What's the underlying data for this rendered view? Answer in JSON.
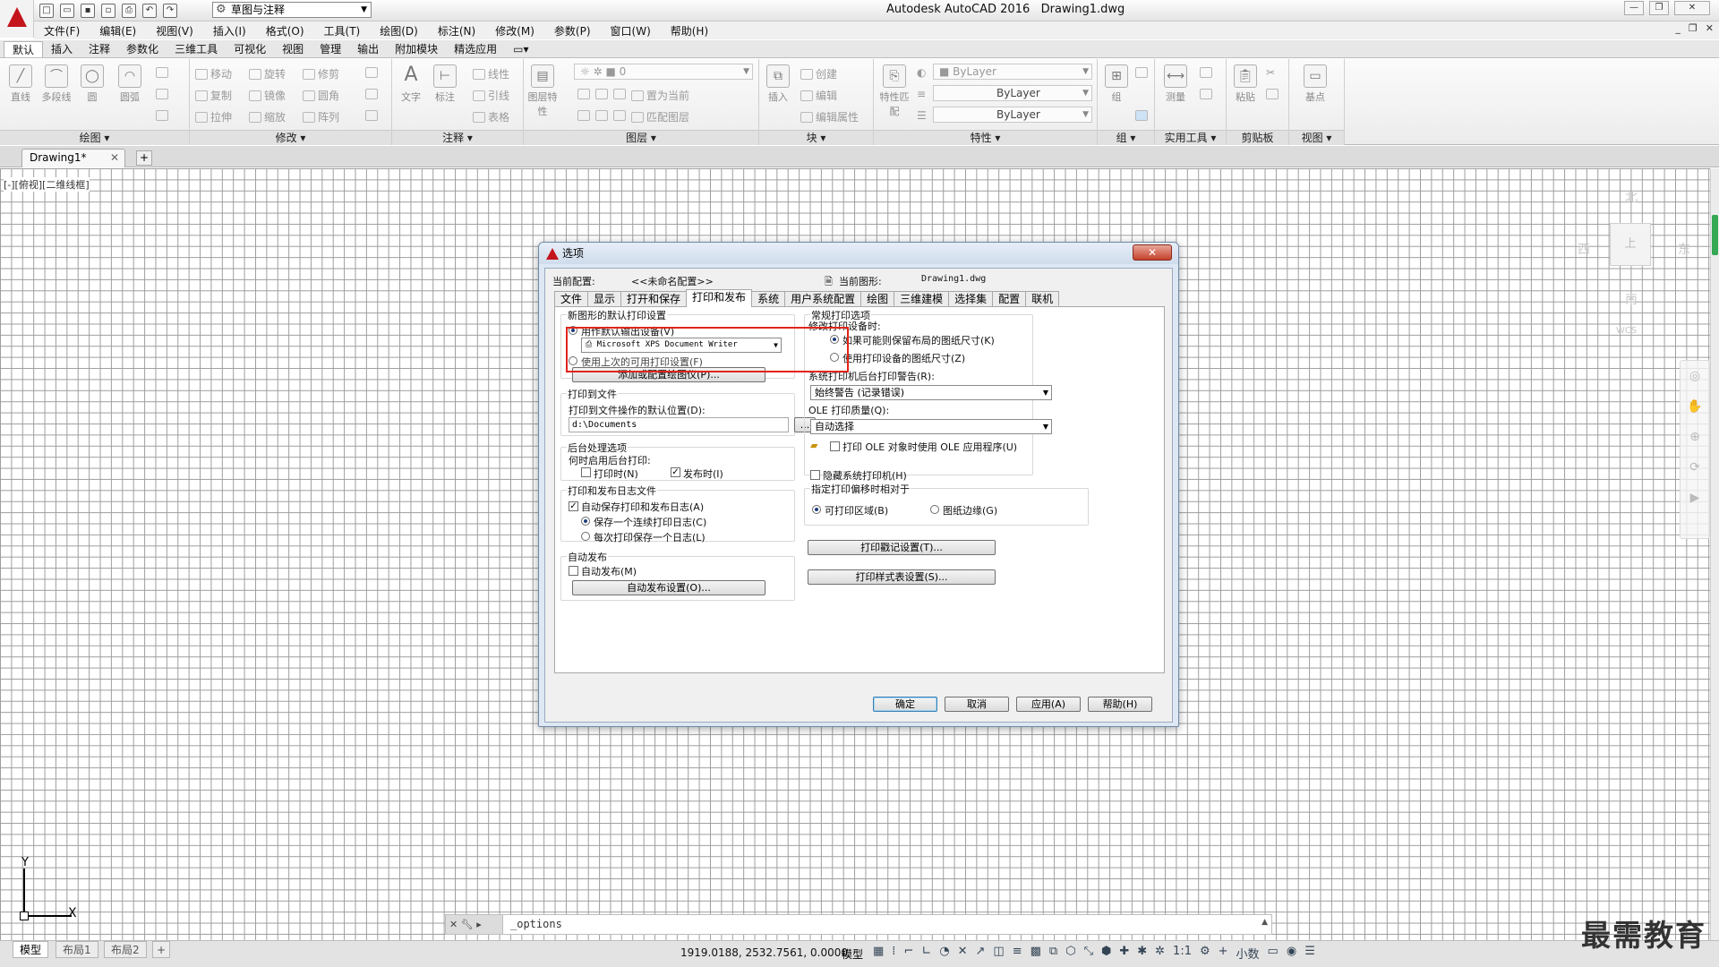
{
  "app": {
    "title": "Autodesk AutoCAD 2016",
    "document": "Drawing1.dwg",
    "workspace": "草图与注释"
  },
  "menu": [
    "文件(F)",
    "编辑(E)",
    "视图(V)",
    "插入(I)",
    "格式(O)",
    "工具(T)",
    "绘图(D)",
    "标注(N)",
    "修改(M)",
    "参数(P)",
    "窗口(W)",
    "帮助(H)"
  ],
  "ribbon_tabs": [
    "默认",
    "插入",
    "注释",
    "参数化",
    "三维工具",
    "可视化",
    "视图",
    "管理",
    "输出",
    "附加模块",
    "精选应用"
  ],
  "ribbon": {
    "draw": {
      "title": "绘图",
      "items": [
        "直线",
        "多段线",
        "圆",
        "圆弧"
      ]
    },
    "modify": {
      "title": "修改",
      "items": [
        "移动",
        "旋转",
        "修剪",
        "复制",
        "镜像",
        "圆角",
        "拉伸",
        "缩放",
        "阵列"
      ]
    },
    "annotation": {
      "title": "注释",
      "items": [
        "文字",
        "标注",
        "线性",
        "引线",
        "表格"
      ]
    },
    "layers": {
      "title": "图层",
      "items": [
        "图层特性",
        "置为当前",
        "匹配图层"
      ],
      "layer_value": "0"
    },
    "block": {
      "title": "块",
      "items": [
        "插入",
        "创建",
        "编辑",
        "编辑属性"
      ]
    },
    "properties": {
      "title": "特性",
      "items": [
        "特性匹配"
      ],
      "color": "ByLayer",
      "linetype": "ByLayer",
      "lineweight": "ByLayer"
    },
    "groups": {
      "title": "组",
      "items": [
        "组"
      ]
    },
    "utilities": {
      "title": "实用工具",
      "items": [
        "测量"
      ]
    },
    "clipboard": {
      "title": "剪贴板",
      "items": [
        "粘贴"
      ]
    },
    "view": {
      "title": "视图",
      "items": [
        "基点"
      ]
    }
  },
  "doc_tab": "Drawing1*",
  "viewport_label": "[-][俯视][二维线框]",
  "viewcube": {
    "north": "北",
    "south": "南",
    "east": "东",
    "west": "西",
    "top": "上",
    "wcs": "WCS"
  },
  "ucs": {
    "x": "X",
    "y": "Y"
  },
  "command_line": "_options",
  "layout_tabs": [
    "模型",
    "布局1",
    "布局2"
  ],
  "status": {
    "coords": "1919.0188, 2532.7561, 0.0000",
    "model": "模型",
    "scale": "1:1",
    "units": "小数"
  },
  "watermark": "最需教育",
  "dialog": {
    "title": "选项",
    "close": "关闭",
    "current_profile_label": "当前配置:",
    "current_profile": "<<未命名配置>>",
    "current_drawing_label": "当前图形:",
    "current_drawing": "Drawing1.dwg",
    "tabs": [
      "文件",
      "显示",
      "打开和保存",
      "打印和发布",
      "系统",
      "用户系统配置",
      "绘图",
      "三维建模",
      "选择集",
      "配置",
      "联机"
    ],
    "default_print": {
      "title": "新图形的默认打印设置",
      "use_default_device": "用作默认输出设备(V)",
      "device": "Microsoft XPS Document Writer",
      "use_last": "使用上次的可用打印设置(F)",
      "add_plotter": "添加或配置绘图仪(P)..."
    },
    "print_to_file": {
      "title": "打印到文件",
      "label": "打印到文件操作的默认位置(D):",
      "path": "d:\\Documents",
      "browse": "..."
    },
    "background": {
      "title": "后台处理选项",
      "label": "何时启用后台打印:",
      "when_print": "打印时(N)",
      "when_publish": "发布时(I)",
      "when_print_checked": false,
      "when_publish_checked": true
    },
    "log": {
      "title": "打印和发布日志文件",
      "auto_save": "自动保存打印和发布日志(A)",
      "continuous": "保存一个连续打印日志(C)",
      "per_print": "每次打印保存一个日志(L)"
    },
    "auto_publish": {
      "title": "自动发布",
      "auto": "自动发布(M)",
      "settings": "自动发布设置(O)..."
    },
    "general": {
      "title": "常规打印选项",
      "modify_label": "修改打印设备时:",
      "keep_layout_size": "如果可能则保留布局的图纸尺寸(K)",
      "use_device_size": "使用打印设备的图纸尺寸(Z)",
      "spool_label": "系统打印机后台打印警告(R):",
      "spool_value": "始终警告 (记录错误)",
      "ole_label": "OLE 打印质量(Q):",
      "ole_value": "自动选择",
      "ole_app": "打印 OLE 对象时使用 OLE 应用程序(U)",
      "hide_sys": "隐藏系统打印机(H)"
    },
    "offset": {
      "title": "指定打印偏移时相对于",
      "printable": "可打印区域(B)",
      "edge": "图纸边缘(G)"
    },
    "stamp_btn": "打印戳记设置(T)...",
    "style_btn": "打印样式表设置(S)...",
    "buttons": {
      "ok": "确定",
      "cancel": "取消",
      "apply": "应用(A)",
      "help": "帮助(H)"
    }
  }
}
